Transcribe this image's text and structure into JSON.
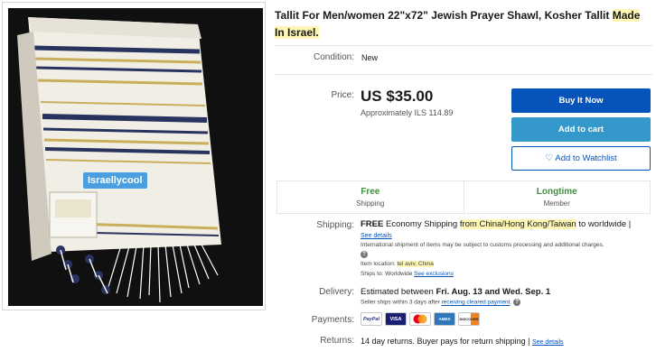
{
  "photo": {
    "watermark": "Israellycool"
  },
  "title": {
    "main": "Tallit For Men/women 22\"x72\" Jewish Prayer Shawl, Kosher Tallit ",
    "highlight": "Made In Israel."
  },
  "condition": {
    "label": "Condition:",
    "value": "New"
  },
  "price": {
    "label": "Price:",
    "value": "US $35.00",
    "approx": "Approximately ILS 114.89"
  },
  "buttons": {
    "buy": "Buy It Now",
    "cart": "Add to cart",
    "watchlist": "Add to Watchlist",
    "watch_icon": "heart-icon"
  },
  "badges": [
    {
      "top": "Free",
      "bottom": "Shipping"
    },
    {
      "top": "Longtime",
      "bottom": "Member"
    }
  ],
  "shipping": {
    "label": "Shipping:",
    "free": "FREE",
    "service": "Economy Shipping",
    "origin": "from China/Hong Kong/Taiwan",
    "dest": "to worldwide",
    "sep": "|",
    "see_details": "See details",
    "intl_note": "International shipment of items may be subject to customs processing and additional charges.",
    "location_label": "Item location:",
    "location": "tel aviv, China",
    "ships_to_label": "Ships to:",
    "ships_to": "Worldwide",
    "see_exclusions": "See exclusions"
  },
  "delivery": {
    "label": "Delivery:",
    "text": "Estimated between ",
    "dates": "Fri. Aug. 13 and Wed. Sep. 1",
    "note": "Seller ships within 3 days after ",
    "note_link": "receiving cleared payment",
    "note_end": "."
  },
  "payments": {
    "label": "Payments:",
    "methods": [
      "PayPal",
      "VISA",
      "MC",
      "AMEX",
      "DISCOVER"
    ]
  },
  "returns": {
    "label": "Returns:",
    "text": "14 day returns. Buyer pays for return shipping",
    "sep": "|",
    "see_details": "See details"
  },
  "colors": {
    "buy": "#0654ba",
    "cart": "#3498ca",
    "highlight": "#fdf6b5",
    "badge_green": "#3f8f3f"
  }
}
